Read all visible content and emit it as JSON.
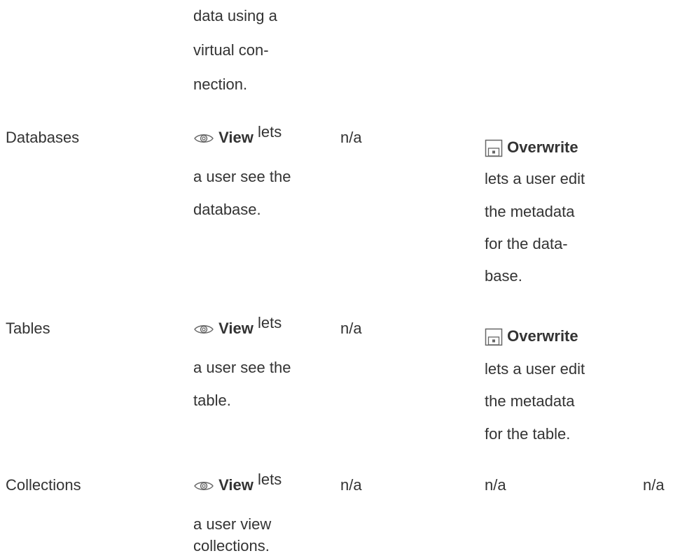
{
  "intro_lines": [
    "data using a",
    "virtual con-",
    "nection."
  ],
  "rows": [
    {
      "name": "Databases",
      "view_label": "View",
      "view_suffix": "lets",
      "view_desc": [
        "a user see the",
        "database."
      ],
      "col3": "n/a",
      "overwrite_label": "Overwrite",
      "overwrite_desc": [
        "lets a user edit",
        "the metadata",
        "for the data-",
        "base."
      ]
    },
    {
      "name": "Tables",
      "view_label": "View",
      "view_suffix": "lets",
      "view_desc": [
        "a user see the",
        "table."
      ],
      "col3": "n/a",
      "overwrite_label": "Overwrite",
      "overwrite_desc": [
        "lets a user edit",
        "the metadata",
        "for the table."
      ]
    },
    {
      "name": "Collections",
      "view_label": "View",
      "view_suffix": "lets",
      "view_desc": [
        "a user view",
        "collections."
      ],
      "col3": "n/a",
      "col4": "n/a",
      "col5": "n/a"
    }
  ],
  "icons": {
    "view": "eye-icon",
    "overwrite": "save-icon"
  },
  "colors": {
    "text": "#333333",
    "icon": "#666666"
  }
}
